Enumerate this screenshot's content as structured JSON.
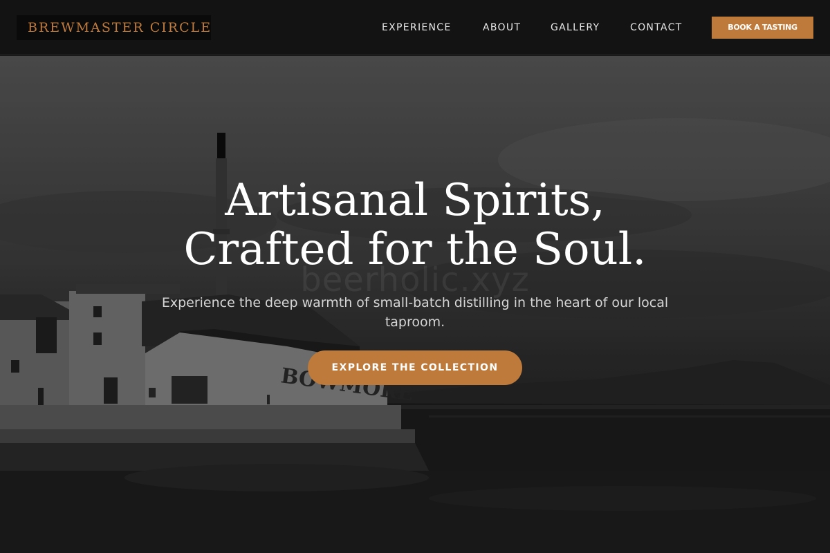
{
  "brand": {
    "name": "BREWMASTER CIRCLE",
    "accent": "#bd7a3a"
  },
  "nav": {
    "items": [
      {
        "label": "EXPERIENCE"
      },
      {
        "label": "ABOUT"
      },
      {
        "label": "GALLERY"
      },
      {
        "label": "CONTACT"
      }
    ],
    "cta_label": "BOOK A TASTING"
  },
  "hero": {
    "title_line1": "Artisanal Spirits,",
    "title_line2": "Crafted for the Soul.",
    "subtitle": "Experience the deep warmth of small-batch distilling in the heart of our local taproom.",
    "cta_label": "EXPLORE THE COLLECTION",
    "watermark": "beerholic.xyz",
    "building_sign": "BOWMORE",
    "background_description_icon": "distillery-photo"
  }
}
